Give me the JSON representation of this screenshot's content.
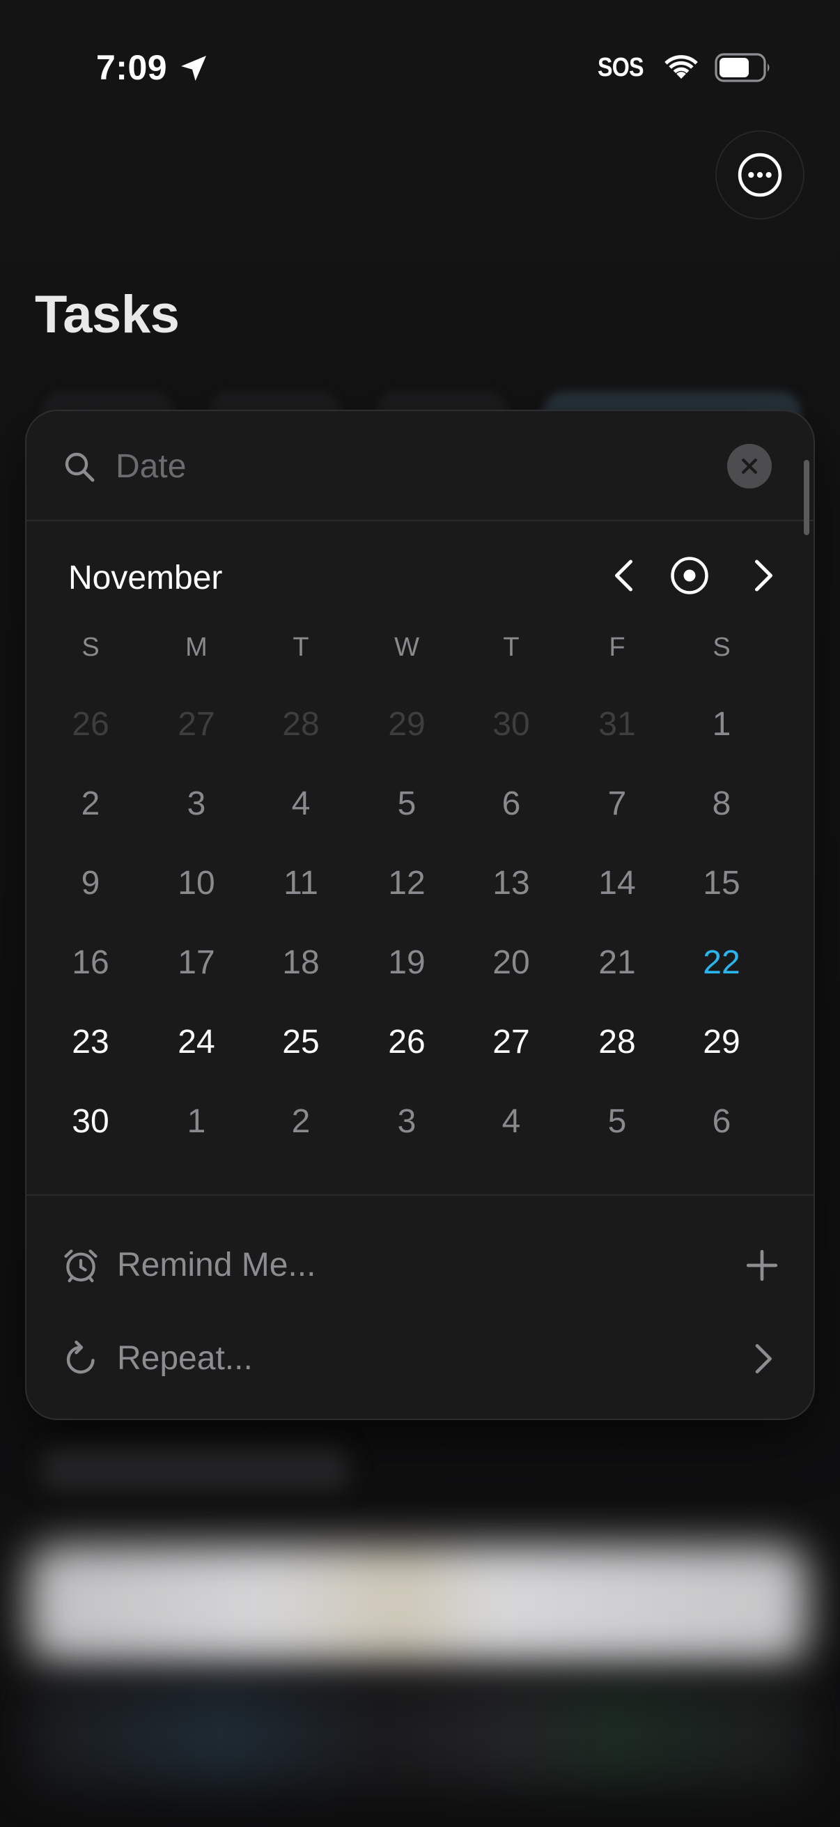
{
  "status_bar": {
    "time": "7:09",
    "sos": "SOS",
    "icons": [
      "location-arrow-icon",
      "wifi-icon",
      "battery-icon"
    ]
  },
  "header": {
    "title": "Tasks",
    "more_icon": "ellipsis-circle-icon"
  },
  "date_picker": {
    "search": {
      "placeholder": "Date",
      "value": "",
      "icon": "search-icon",
      "clear_icon": "close-icon"
    },
    "month": "November",
    "nav_icons": [
      "chevron-left-icon",
      "today-target-icon",
      "chevron-right-icon"
    ],
    "weekdays": [
      "S",
      "M",
      "T",
      "W",
      "T",
      "F",
      "S"
    ],
    "weeks": [
      [
        {
          "d": "26",
          "s": "outside"
        },
        {
          "d": "27",
          "s": "outside"
        },
        {
          "d": "28",
          "s": "outside"
        },
        {
          "d": "29",
          "s": "outside"
        },
        {
          "d": "30",
          "s": "outside"
        },
        {
          "d": "31",
          "s": "outside"
        },
        {
          "d": "1",
          "s": "past"
        }
      ],
      [
        {
          "d": "2",
          "s": "past"
        },
        {
          "d": "3",
          "s": "past"
        },
        {
          "d": "4",
          "s": "past"
        },
        {
          "d": "5",
          "s": "past"
        },
        {
          "d": "6",
          "s": "past"
        },
        {
          "d": "7",
          "s": "past"
        },
        {
          "d": "8",
          "s": "past"
        }
      ],
      [
        {
          "d": "9",
          "s": "past"
        },
        {
          "d": "10",
          "s": "past"
        },
        {
          "d": "11",
          "s": "past"
        },
        {
          "d": "12",
          "s": "past"
        },
        {
          "d": "13",
          "s": "past"
        },
        {
          "d": "14",
          "s": "past"
        },
        {
          "d": "15",
          "s": "past"
        }
      ],
      [
        {
          "d": "16",
          "s": "past"
        },
        {
          "d": "17",
          "s": "past"
        },
        {
          "d": "18",
          "s": "past"
        },
        {
          "d": "19",
          "s": "past"
        },
        {
          "d": "20",
          "s": "past"
        },
        {
          "d": "21",
          "s": "past"
        },
        {
          "d": "22",
          "s": "today"
        }
      ],
      [
        {
          "d": "23",
          "s": "future"
        },
        {
          "d": "24",
          "s": "future"
        },
        {
          "d": "25",
          "s": "future"
        },
        {
          "d": "26",
          "s": "future"
        },
        {
          "d": "27",
          "s": "future"
        },
        {
          "d": "28",
          "s": "future"
        },
        {
          "d": "29",
          "s": "future"
        }
      ],
      [
        {
          "d": "30",
          "s": "future"
        },
        {
          "d": "1",
          "s": "next-month"
        },
        {
          "d": "2",
          "s": "next-month"
        },
        {
          "d": "3",
          "s": "next-month"
        },
        {
          "d": "4",
          "s": "next-month"
        },
        {
          "d": "5",
          "s": "next-month"
        },
        {
          "d": "6",
          "s": "next-month"
        }
      ]
    ],
    "options": {
      "remind": {
        "label": "Remind Me...",
        "icon": "alarm-clock-icon",
        "action_icon": "plus-icon"
      },
      "repeat": {
        "label": "Repeat...",
        "icon": "repeat-icon",
        "action_icon": "chevron-right-icon"
      }
    }
  },
  "colors": {
    "background": "#131314",
    "popover": "#1a1a1b",
    "today_accent": "#2bb5ef",
    "muted_text": "#8a8a8e",
    "outside_text": "#3e3e41"
  }
}
